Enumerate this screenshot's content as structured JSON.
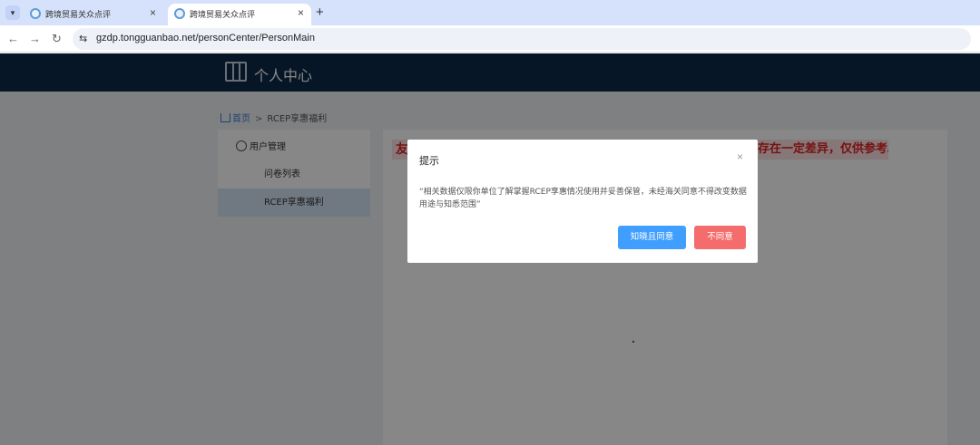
{
  "browser": {
    "tabs": [
      {
        "title": "跨境贸易关众点评",
        "active": false
      },
      {
        "title": "跨境贸易关众点评",
        "active": true
      }
    ],
    "url": "gzdp.tongguanbao.net/personCenter/PersonMain"
  },
  "header": {
    "title": "个人中心"
  },
  "breadcrumb": {
    "home": "首页",
    "separator": ">",
    "current": "RCEP享惠福利"
  },
  "sidebar": {
    "group": "用户管理",
    "items": [
      {
        "label": "问卷列表",
        "selected": false
      },
      {
        "label": "RCEP享惠福利",
        "selected": true
      }
    ]
  },
  "content": {
    "notice_left": "友",
    "notice_right": "存在一定差异，仅供参考。"
  },
  "dialog": {
    "title": "提示",
    "close": "×",
    "body": "“相关数据仅限你单位了解掌握RCEP享惠情况使用并妥善保管，未经海关同意不得改变数据用途与知悉范围”",
    "agree": "知晓且同意",
    "disagree": "不同意"
  },
  "colors": {
    "header_bg": "#0e2a4a",
    "primary": "#409eff",
    "danger": "#f56c6c",
    "notice_text": "#e02020"
  }
}
